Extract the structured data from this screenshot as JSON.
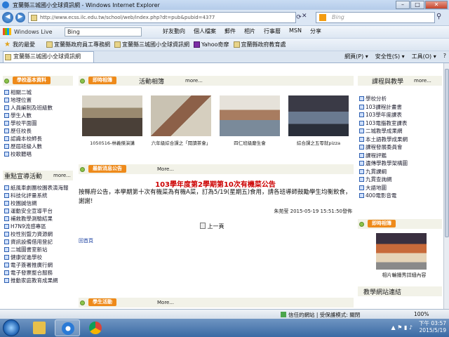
{
  "window": {
    "title": "宜蘭縣三城國小全球資訊網 - Windows Internet Explorer",
    "min": "–",
    "max": "□",
    "close": "✕"
  },
  "address": {
    "url": "http://www.ecss.ilc.edu.tw/school/web/index.php?dt=pub&pubid=4377",
    "search_placeholder": "Bing"
  },
  "nav": {
    "back": "◀",
    "forward": "▶",
    "refresh": "⟳",
    "stop": "✕",
    "go": "⚲"
  },
  "windows_live": {
    "logo": "Windows Live",
    "search_value": "Bing",
    "menu": [
      "好友動向",
      "個人檔案",
      "郵件",
      "相片",
      "行事曆",
      "MSN",
      "分享"
    ]
  },
  "favorites": {
    "label": "我的最愛",
    "items": [
      "宜蘭縣政府員工專務網",
      "宜蘭縣三城國小全球資訊網",
      "Yahoo奇摩",
      "宜蘭縣政府教育處"
    ]
  },
  "tab": {
    "label": "宜蘭縣三城國小全球資訊網"
  },
  "commands": [
    "網頁(P) ▾",
    "安全性(S) ▾",
    "工具(O) ▾",
    "?"
  ],
  "left_panel": {
    "badge": "學校基本資料",
    "items": [
      "相關二城",
      "地理位置",
      "人員編制及班級數",
      "學生人數",
      "學校平面圖",
      "歷任校長",
      "認識本校師長",
      "歷屆班級人數",
      "校歌聽唱"
    ]
  },
  "promo_panel": {
    "title": "重點宣導活動",
    "more": "more...",
    "items": [
      "紙風車劇團校園表演海報",
      "科技化評量系統",
      "校園誠信網",
      "運動安全宣導平台",
      "補救教學測驗結果",
      "H7N9流感專區",
      "校性別暨力資源網",
      "資訊設備借用登記",
      "二城圖書室新站",
      "健康促進學校",
      "電子簽署推廣行網",
      "電子發票整合服務",
      "推動家庭教育成果網"
    ]
  },
  "photo_panel": {
    "badge": "即時相簿",
    "title": "活動相簿",
    "more": "more...",
    "photos": [
      {
        "caption": "1050516-林義傑演講"
      },
      {
        "caption": "六年級綜合課之「閱讀茶會」"
      },
      {
        "caption": "四仁班級慶生會"
      },
      {
        "caption": "綜合課之五零就pizza"
      }
    ]
  },
  "news_panel": {
    "badge": "最新消息公告",
    "more": "More...",
    "headline": "103學年度第2學期第10次有機菜公告",
    "body": "按縣府公告，本學期第十次有機菜為有機A菜，訂為5/19(星期五)食用，請各班導師鼓勵學生均衡飲食，謝謝!",
    "meta": "朱苑莹  2015-05-19 15:51:50發佈",
    "prev": "上一頁",
    "home": "回首頁",
    "next_badge": "學生活動",
    "next_more": "More..."
  },
  "right_panel": {
    "title": "課程與教學",
    "more": "more...",
    "items": [
      "學校分析",
      "103課程計畫書",
      "103學年度課表",
      "103電腦教室課表",
      "二城教學成果網",
      "本土語教學成果網",
      "課程發展委員會",
      "課程評鑑",
      "遺傳學教學架構圖",
      "九貫課綱",
      "九貫查詢網",
      "大語地圖",
      "400電影音電"
    ]
  },
  "right_photo_panel": {
    "badge": "即時相簿",
    "caption": "相片輪播秀詳細內容"
  },
  "right_links_panel": {
    "title": "教學網站連結"
  },
  "status": {
    "zone": "信任的網站 | 受保護模式: 關閉",
    "zoom": "100%"
  },
  "taskbar": {
    "time": "下午 03:57",
    "date": "2015/5/19"
  },
  "colors": {
    "badge_orange": "#ee8a1a",
    "headline_red": "#cc0000",
    "section_band": "#f2f2e8"
  }
}
